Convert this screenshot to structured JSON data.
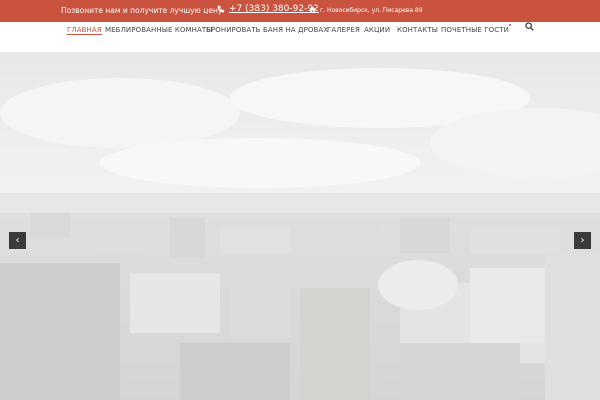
{
  "topbar": {
    "cta": "Позвоните нам и получите лучшую цену",
    "phone": "+7 (383) 380-92-92",
    "address": "г. Новосибирск, ул. Писарева 89"
  },
  "nav": {
    "items": [
      {
        "label": "Главная",
        "active": true
      },
      {
        "label": "Меблированные комнаты",
        "active": false
      },
      {
        "label": "Бронировать",
        "active": false
      },
      {
        "label": "Баня на дровах",
        "active": false
      },
      {
        "label": "Галерея",
        "active": false
      },
      {
        "label": "Акции",
        "active": false
      },
      {
        "label": "Контакты",
        "active": false
      },
      {
        "label": "Почетные гости",
        "active": false
      }
    ]
  },
  "slider": {
    "prev_glyph": "‹",
    "next_glyph": "›"
  },
  "colors": {
    "accent": "#c9533f",
    "nav_text": "#444444",
    "arrow_bg": "#3b3b3b"
  },
  "icons": {
    "phone": "phone-icon",
    "home": "home-icon",
    "search": "search-icon"
  }
}
